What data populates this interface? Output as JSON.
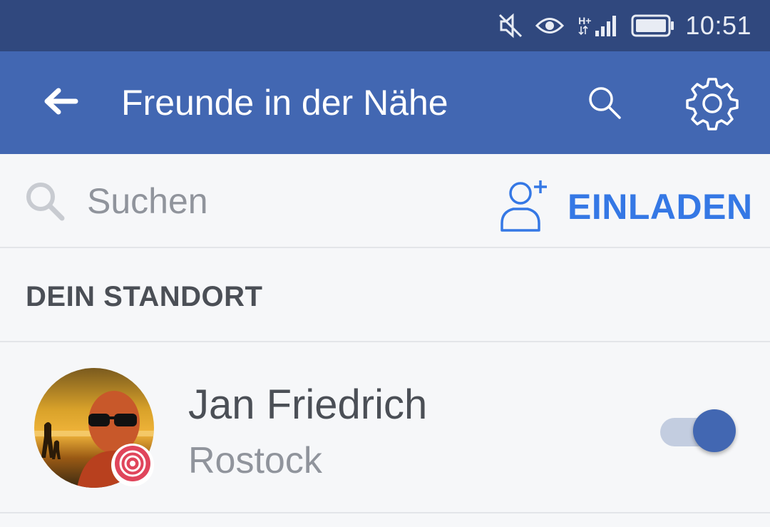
{
  "status_bar": {
    "time": "10:51",
    "network": "H+",
    "icons": [
      "mute-icon",
      "eye-icon",
      "network-icon",
      "signal-icon",
      "battery-icon"
    ]
  },
  "app_bar": {
    "title": "Freunde in der Nähe",
    "icons": [
      "back-arrow-icon",
      "search-icon",
      "gear-icon"
    ]
  },
  "search": {
    "placeholder": "Suchen",
    "value": "",
    "invite_label": "EINLADEN"
  },
  "section": {
    "title": "DEIN STANDORT"
  },
  "user": {
    "name": "Jan Friedrich",
    "location": "Rostock",
    "sharing_enabled": true
  },
  "colors": {
    "status_bar": "#30487e",
    "app_bar": "#4267b2",
    "accent": "#3578e5",
    "badge": "#e0455b",
    "background": "#f6f7f9"
  }
}
